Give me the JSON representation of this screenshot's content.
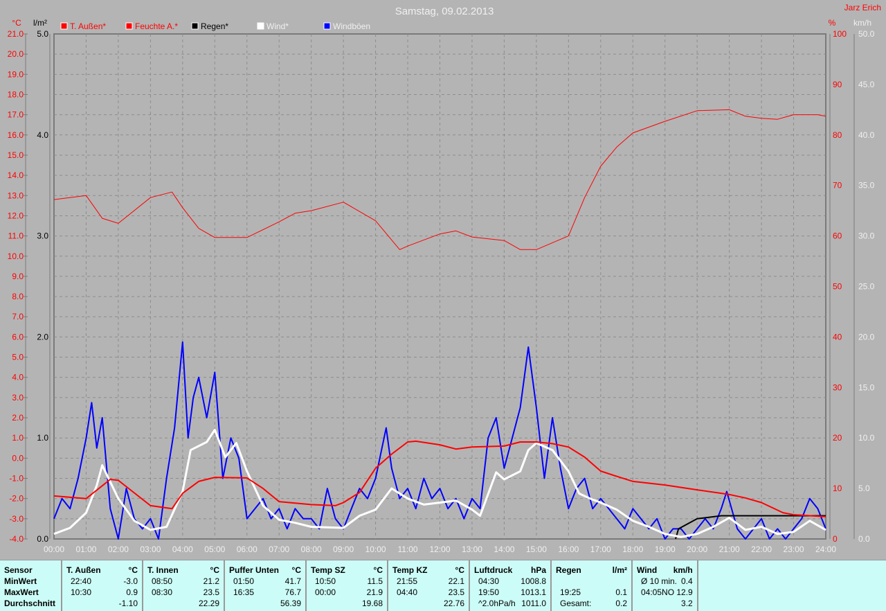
{
  "title": "Samstag, 09.02.2013",
  "author": "Jarz Erich",
  "colors": {
    "temp": "#ff0000",
    "humidity": "#ff0000",
    "rain": "#000000",
    "wind": "#ffffff",
    "gusts": "#0000ff",
    "grid": "#8c8c8c",
    "background": "#b4b4b4"
  },
  "chart_data": {
    "type": "line",
    "title": "Samstag, 09.02.2013",
    "axes": {
      "temp": {
        "label": "°C",
        "range": [
          -4,
          21
        ],
        "ticks": [
          "21.0",
          "20.0",
          "19.0",
          "18.0",
          "17.0",
          "16.0",
          "15.0",
          "14.0",
          "13.0",
          "12.0",
          "11.0",
          "10.0",
          "9.0",
          "8.0",
          "7.0",
          "6.0",
          "5.0",
          "4.0",
          "3.0",
          "2.0",
          "1.0",
          "0.0",
          "-1.0",
          "-2.0",
          "-3.0",
          "-4.0"
        ]
      },
      "rain": {
        "label": "l/m²",
        "range": [
          0,
          5
        ],
        "ticks": [
          "5.0",
          "4.0",
          "3.0",
          "2.0",
          "1.0",
          "0.0"
        ]
      },
      "humidity": {
        "label": "%",
        "range": [
          0,
          100
        ],
        "ticks": [
          "100",
          "90",
          "80",
          "70",
          "60",
          "50",
          "40",
          "30",
          "20",
          "10",
          "0"
        ]
      },
      "wind": {
        "label": "km/h",
        "range": [
          0,
          50
        ],
        "ticks": [
          "50.0",
          "45.0",
          "40.0",
          "35.0",
          "30.0",
          "25.0",
          "20.0",
          "15.0",
          "10.0",
          "5.0",
          "0.0"
        ]
      },
      "x": {
        "range": [
          0,
          24
        ],
        "ticks": [
          "00:00",
          "01:00",
          "02:00",
          "03:00",
          "04:00",
          "05:00",
          "06:00",
          "07:00",
          "08:00",
          "09:00",
          "10:00",
          "11:00",
          "12:00",
          "13:00",
          "14:00",
          "15:00",
          "16:00",
          "17:00",
          "18:00",
          "19:00",
          "20:00",
          "21:00",
          "22:00",
          "23:00",
          "24:00"
        ]
      }
    },
    "grid": true,
    "legend_placement": "top",
    "series": [
      {
        "name": "T. Außen*",
        "axis": "temp",
        "color": "#ff0000",
        "width": 2,
        "points": [
          [
            0,
            -1.87
          ],
          [
            1,
            -2.0
          ],
          [
            1.75,
            -1.05
          ],
          [
            2,
            -1.1
          ],
          [
            3,
            -2.35
          ],
          [
            3.67,
            -2.5
          ],
          [
            4,
            -1.74
          ],
          [
            4.5,
            -1.15
          ],
          [
            5,
            -0.95
          ],
          [
            6,
            -0.98
          ],
          [
            6.5,
            -1.5
          ],
          [
            7,
            -2.15
          ],
          [
            8,
            -2.3
          ],
          [
            8.75,
            -2.35
          ],
          [
            9,
            -2.2
          ],
          [
            9.5,
            -1.7
          ],
          [
            10,
            -0.5
          ],
          [
            10.5,
            0.2
          ],
          [
            11,
            0.8
          ],
          [
            11.25,
            0.84
          ],
          [
            12,
            0.66
          ],
          [
            12.5,
            0.45
          ],
          [
            13,
            0.55
          ],
          [
            14,
            0.6
          ],
          [
            14.5,
            0.8
          ],
          [
            15,
            0.8
          ],
          [
            15.5,
            0.72
          ],
          [
            16,
            0.55
          ],
          [
            16.5,
            0.05
          ],
          [
            17,
            -0.64
          ],
          [
            17.5,
            -0.9
          ],
          [
            18,
            -1.15
          ],
          [
            19,
            -1.33
          ],
          [
            20,
            -1.57
          ],
          [
            21,
            -1.8
          ],
          [
            21.5,
            -1.97
          ],
          [
            22,
            -2.2
          ],
          [
            22.67,
            -2.7
          ],
          [
            23,
            -2.8
          ],
          [
            24,
            -2.9
          ]
        ]
      },
      {
        "name": "Feuchte A.*",
        "axis": "humidity",
        "color": "#ff0000",
        "width": 1,
        "points": [
          [
            0,
            67.2
          ],
          [
            1,
            68
          ],
          [
            1.5,
            63.5
          ],
          [
            2,
            62.5
          ],
          [
            3,
            67.6
          ],
          [
            3.67,
            68.7
          ],
          [
            4,
            65.6
          ],
          [
            4.5,
            61.5
          ],
          [
            5,
            59.7
          ],
          [
            6,
            59.7
          ],
          [
            7,
            62.8
          ],
          [
            7.5,
            64.5
          ],
          [
            8,
            65
          ],
          [
            9,
            66.7
          ],
          [
            10,
            63
          ],
          [
            10.75,
            57.3
          ],
          [
            11,
            58
          ],
          [
            12,
            60.4
          ],
          [
            12.5,
            61
          ],
          [
            13,
            59.8
          ],
          [
            14,
            59.1
          ],
          [
            14.5,
            57.3
          ],
          [
            15,
            57.3
          ],
          [
            16,
            60
          ],
          [
            16.5,
            67.6
          ],
          [
            17,
            73.8
          ],
          [
            17.5,
            77.6
          ],
          [
            18,
            80.4
          ],
          [
            19,
            82.7
          ],
          [
            20,
            84.8
          ],
          [
            21,
            85
          ],
          [
            21.5,
            83.7
          ],
          [
            22,
            83.3
          ],
          [
            22.5,
            83.1
          ],
          [
            23,
            84
          ],
          [
            23.75,
            84
          ],
          [
            24,
            83.7
          ]
        ]
      },
      {
        "name": "Regen*",
        "axis": "rain",
        "color": "#000000",
        "width": 2,
        "points": [
          [
            19.33,
            0
          ],
          [
            19.42,
            0.1
          ],
          [
            20,
            0.2
          ],
          [
            20.75,
            0.23
          ],
          [
            24,
            0.23
          ]
        ]
      },
      {
        "name": "Wind*",
        "axis": "wind",
        "color": "#ffffff",
        "width": 3,
        "points": [
          [
            0,
            0.5
          ],
          [
            0.5,
            1.1
          ],
          [
            1,
            2.6
          ],
          [
            1.33,
            5.3
          ],
          [
            1.5,
            7.3
          ],
          [
            2,
            4
          ],
          [
            2.5,
            1.8
          ],
          [
            3,
            0.9
          ],
          [
            3.5,
            1.2
          ],
          [
            4,
            4.7
          ],
          [
            4.25,
            8.8
          ],
          [
            4.75,
            9.6
          ],
          [
            5,
            10.8
          ],
          [
            5.33,
            8.1
          ],
          [
            5.67,
            9.5
          ],
          [
            6,
            6.7
          ],
          [
            6.5,
            3.3
          ],
          [
            7,
            1.9
          ],
          [
            7.5,
            1.6
          ],
          [
            8,
            1.2
          ],
          [
            9,
            1.1
          ],
          [
            9.5,
            2.3
          ],
          [
            10,
            2.9
          ],
          [
            10.5,
            5
          ],
          [
            11,
            4
          ],
          [
            11.5,
            3.4
          ],
          [
            12,
            3.6
          ],
          [
            12.5,
            3.8
          ],
          [
            13,
            2.9
          ],
          [
            13.25,
            2.3
          ],
          [
            13.75,
            6.6
          ],
          [
            14,
            5.9
          ],
          [
            14.5,
            6.7
          ],
          [
            14.75,
            8.8
          ],
          [
            15,
            9.5
          ],
          [
            15.5,
            8.8
          ],
          [
            16,
            6.7
          ],
          [
            16.33,
            4.5
          ],
          [
            16.67,
            4
          ],
          [
            17,
            3.6
          ],
          [
            17.5,
            2.9
          ],
          [
            18,
            1.8
          ],
          [
            18.5,
            1.2
          ],
          [
            19,
            0.5
          ],
          [
            19.5,
            0.2
          ],
          [
            20,
            0.5
          ],
          [
            20.5,
            1.2
          ],
          [
            21,
            2.1
          ],
          [
            21.5,
            0.9
          ],
          [
            22,
            1.2
          ],
          [
            22.5,
            0.5
          ],
          [
            23,
            0.7
          ],
          [
            23.5,
            1.8
          ],
          [
            24,
            0.9
          ]
        ]
      },
      {
        "name": "Windböen",
        "axis": "wind",
        "color": "#0000ff",
        "width": 2,
        "points": [
          [
            0,
            2
          ],
          [
            0.25,
            4
          ],
          [
            0.5,
            3
          ],
          [
            0.75,
            6
          ],
          [
            1,
            10
          ],
          [
            1.17,
            13.5
          ],
          [
            1.33,
            9
          ],
          [
            1.5,
            12
          ],
          [
            1.75,
            3
          ],
          [
            2,
            0
          ],
          [
            2.25,
            5
          ],
          [
            2.5,
            2
          ],
          [
            2.75,
            1
          ],
          [
            3,
            2
          ],
          [
            3.25,
            0
          ],
          [
            3.5,
            6
          ],
          [
            3.75,
            11
          ],
          [
            4,
            19.5
          ],
          [
            4.17,
            10
          ],
          [
            4.33,
            14
          ],
          [
            4.5,
            16
          ],
          [
            4.75,
            12
          ],
          [
            5,
            16.5
          ],
          [
            5.25,
            6
          ],
          [
            5.5,
            10
          ],
          [
            5.75,
            8
          ],
          [
            6,
            2
          ],
          [
            6.25,
            3
          ],
          [
            6.5,
            4
          ],
          [
            6.75,
            2
          ],
          [
            7,
            3
          ],
          [
            7.25,
            1
          ],
          [
            7.5,
            3
          ],
          [
            7.75,
            2
          ],
          [
            8,
            2
          ],
          [
            8.25,
            1
          ],
          [
            8.5,
            5
          ],
          [
            8.75,
            2
          ],
          [
            9,
            1
          ],
          [
            9.25,
            3
          ],
          [
            9.5,
            5
          ],
          [
            9.75,
            4
          ],
          [
            10,
            6
          ],
          [
            10.33,
            11
          ],
          [
            10.5,
            7
          ],
          [
            10.75,
            4
          ],
          [
            11,
            5
          ],
          [
            11.25,
            3
          ],
          [
            11.5,
            6
          ],
          [
            11.75,
            4
          ],
          [
            12,
            5
          ],
          [
            12.25,
            3
          ],
          [
            12.5,
            4
          ],
          [
            12.75,
            2
          ],
          [
            13,
            4
          ],
          [
            13.25,
            3
          ],
          [
            13.5,
            10
          ],
          [
            13.75,
            12
          ],
          [
            14,
            7
          ],
          [
            14.25,
            10
          ],
          [
            14.5,
            13
          ],
          [
            14.75,
            19
          ],
          [
            15,
            13
          ],
          [
            15.25,
            6
          ],
          [
            15.5,
            12
          ],
          [
            15.75,
            7
          ],
          [
            16,
            3
          ],
          [
            16.25,
            5
          ],
          [
            16.5,
            6
          ],
          [
            16.75,
            3
          ],
          [
            17,
            4
          ],
          [
            17.25,
            3
          ],
          [
            17.5,
            2
          ],
          [
            17.75,
            1
          ],
          [
            18,
            3
          ],
          [
            18.25,
            2
          ],
          [
            18.5,
            1
          ],
          [
            18.75,
            2
          ],
          [
            19,
            0
          ],
          [
            19.25,
            1
          ],
          [
            19.5,
            1
          ],
          [
            19.75,
            0
          ],
          [
            20,
            1
          ],
          [
            20.25,
            2
          ],
          [
            20.5,
            1
          ],
          [
            20.75,
            3
          ],
          [
            20.92,
            4.7
          ],
          [
            21.25,
            1
          ],
          [
            21.5,
            0
          ],
          [
            21.75,
            1
          ],
          [
            22,
            2
          ],
          [
            22.25,
            0
          ],
          [
            22.5,
            1
          ],
          [
            22.75,
            0
          ],
          [
            23,
            1
          ],
          [
            23.25,
            2
          ],
          [
            23.5,
            4
          ],
          [
            23.75,
            3
          ],
          [
            24,
            1
          ]
        ]
      }
    ]
  },
  "table": {
    "rowlabels": [
      "Sensor",
      "MinWert",
      "MaxWert",
      "Durchschnitt"
    ],
    "columns": [
      {
        "name": "T. Außen",
        "unit": "°C",
        "min_time": "22:40",
        "min": "-3.0",
        "max_time": "10:30",
        "max": "0.9",
        "avg_label": "",
        "avg": "-1.10"
      },
      {
        "name": "T. Innen",
        "unit": "°C",
        "min_time": "08:50",
        "min": "21.2",
        "max_time": "08:30",
        "max": "23.5",
        "avg_label": "",
        "avg": "22.29"
      },
      {
        "name": "Puffer Unten",
        "unit": "°C",
        "min_time": "01:50",
        "min": "41.7",
        "max_time": "16:35",
        "max": "76.7",
        "avg_label": "",
        "avg": "56.39"
      },
      {
        "name": "Temp SZ",
        "unit": "°C",
        "min_time": "10:50",
        "min": "11.5",
        "max_time": "00:00",
        "max": "21.9",
        "avg_label": "",
        "avg": "19.68"
      },
      {
        "name": "Temp KZ",
        "unit": "°C",
        "min_time": "21:55",
        "min": "22.1",
        "max_time": "04:40",
        "max": "23.5",
        "avg_label": "",
        "avg": "22.76"
      },
      {
        "name": "Luftdruck",
        "unit": "hPa",
        "min_time": "04:30",
        "min": "1008.8",
        "max_time": "19:50",
        "max": "1013.1",
        "avg_label": "^2.0hPa/h",
        "avg": "1011.0"
      },
      {
        "name": "Regen",
        "unit": "l/m²",
        "min_time": "",
        "min": "",
        "max_time": "19:25",
        "max": "0.1",
        "avg_label": "Gesamt:",
        "avg": "0.2"
      },
      {
        "name": "Wind",
        "unit": "km/h",
        "min_time": "Ø 10 min.",
        "min": "0.4",
        "max_time": "04:05",
        "max": "NO 12.9",
        "avg_label": "",
        "avg": "3.2"
      }
    ]
  }
}
